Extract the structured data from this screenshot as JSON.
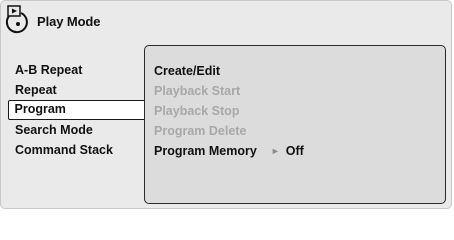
{
  "header": {
    "title": "Play Mode",
    "icon": "play-mode-disc-icon"
  },
  "menu": {
    "items": [
      {
        "label": "A-B Repeat",
        "selected": false
      },
      {
        "label": "Repeat",
        "selected": false
      },
      {
        "label": "Program",
        "selected": true
      },
      {
        "label": "Search Mode",
        "selected": false
      },
      {
        "label": "Command Stack",
        "selected": false
      }
    ]
  },
  "submenu": {
    "items": [
      {
        "label": "Create/Edit",
        "enabled": true
      },
      {
        "label": "Playback Start",
        "enabled": false
      },
      {
        "label": "Playback Stop",
        "enabled": false
      },
      {
        "label": "Program Delete",
        "enabled": false
      },
      {
        "label": "Program Memory",
        "enabled": true,
        "value": "Off",
        "value_icon": "right-triangle-icon"
      }
    ]
  },
  "colors": {
    "screen_background": "#eaeaea",
    "panel_background": "#dcdcdc",
    "disabled_text": "#a8a8a8",
    "text": "#111111",
    "selection_background": "#ffffff"
  }
}
